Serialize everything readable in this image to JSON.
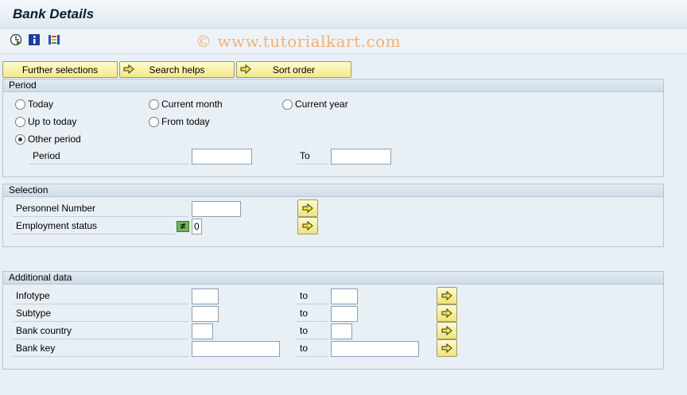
{
  "window": {
    "title": "Bank Details"
  },
  "toolbar": {
    "icons": [
      "execute-icon",
      "info-icon",
      "selection-options-icon"
    ],
    "watermark": "© www.tutorialkart.com"
  },
  "buttons": {
    "further_selections": "Further selections",
    "search_helps": "Search helps",
    "sort_order": "Sort order"
  },
  "period": {
    "header": "Period",
    "options": {
      "today": "Today",
      "current_month": "Current month",
      "current_year": "Current year",
      "up_to_today": "Up to today",
      "from_today": "From today",
      "other_period": "Other period"
    },
    "selected": "Other period",
    "period_label": "Period",
    "to_label": "To",
    "from_value": "",
    "to_value": ""
  },
  "selection": {
    "header": "Selection",
    "personnel_number_label": "Personnel Number",
    "personnel_number_value": "",
    "employment_status_label": "Employment status",
    "employment_status_value": "0",
    "employment_status_operator": "≠"
  },
  "additional": {
    "header": "Additional data",
    "to_label": "to",
    "rows": [
      {
        "label": "Infotype",
        "from": "",
        "to": ""
      },
      {
        "label": "Subtype",
        "from": "",
        "to": ""
      },
      {
        "label": "Bank country",
        "from": "",
        "to": ""
      },
      {
        "label": "Bank key",
        "from": "",
        "to": ""
      }
    ]
  },
  "colors": {
    "background": "#e8eff5",
    "button_yellow": "#f3e98a",
    "group_header": "#cfdce7"
  }
}
